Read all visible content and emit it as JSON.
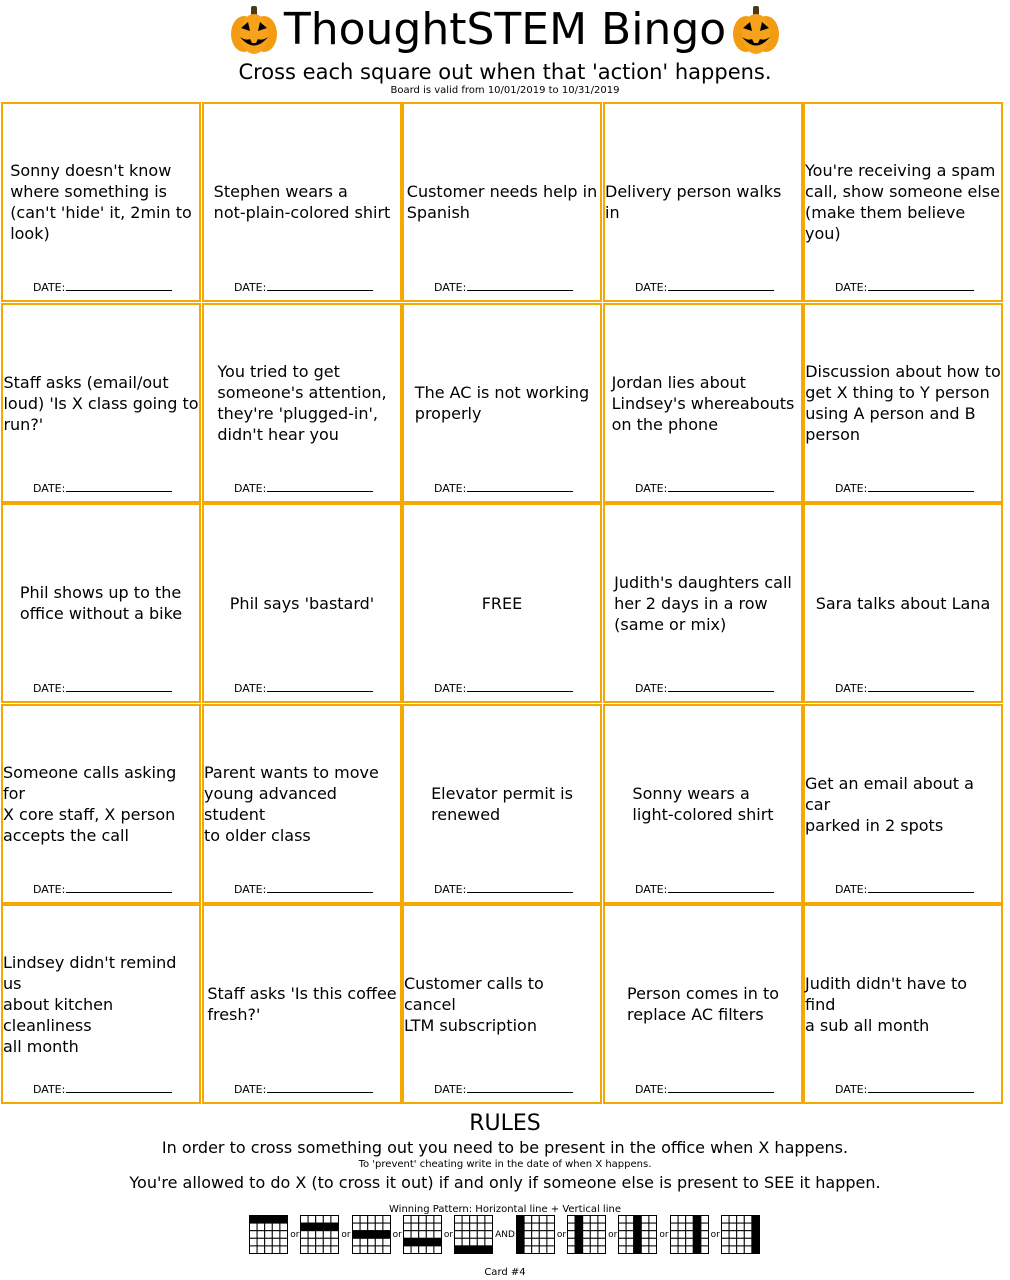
{
  "header": {
    "title": "ThoughtSTEM Bingo",
    "subtitle": "Cross each square out when that 'action' happens.",
    "validity": "Board is valid from 10/01/2019 to 10/31/2019",
    "icon": "pumpkin-icon"
  },
  "board": {
    "date_label": "DATE:",
    "cells": [
      [
        "Sonny doesn't know\nwhere something is\n(can't 'hide' it, 2min to\n look)",
        "Stephen wears a\n not-plain-colored shirt",
        "Customer needs help in\n Spanish",
        "Delivery person walks in",
        "You're receiving a spam\ncall, show someone else\n(make them believe you)"
      ],
      [
        "Staff asks (email/out\nloud) 'Is X class going to\n run?'",
        "You tried to get\nsomeone's attention,\nthey're 'plugged-in',\n didn't hear you",
        "The AC is not working\n properly",
        "Jordan lies about\nLindsey's whereabouts\n on the phone",
        "Discussion about how to\nget X thing to Y person\nusing A person and B\n person"
      ],
      [
        "Phil shows up to the\noffice without a bike",
        "Phil says 'bastard'",
        "FREE",
        "Judith's daughters call\nher 2 days in a row\n (same or mix)",
        "Sara talks about Lana"
      ],
      [
        "Someone calls asking for\nX core staff, X person\n accepts the call",
        "Parent wants to move\nyoung advanced student\n to older class",
        "Elevator permit is\n renewed",
        "Sonny wears a\n light-colored shirt",
        "Get an email about a car\n parked in 2 spots"
      ],
      [
        "Lindsey didn't remind us\nabout kitchen cleanliness\n all month",
        "Staff asks 'Is this coffee\n fresh?'",
        "Customer calls to cancel\n LTM subscription",
        "Person comes in to\n replace AC filters",
        "Judith didn't have to find\n a sub all month"
      ]
    ]
  },
  "rules": {
    "title": "RULES",
    "line1": "In order to cross something out you need to be present in the office when X happens.",
    "small": "To 'prevent' cheating write in the date of when X happens.",
    "line2": "You're allowed to do X (to cross it out) if and only if someone else is present to SEE it happen."
  },
  "winning_pattern": {
    "label": "Winning Pattern: Horizontal line + Vertical line",
    "separators": [
      "or",
      "or",
      "or",
      "or",
      "AND",
      "or",
      "or",
      "or",
      "or"
    ],
    "patterns": [
      {
        "type": "row",
        "index": 0
      },
      {
        "type": "row",
        "index": 1
      },
      {
        "type": "row",
        "index": 2
      },
      {
        "type": "row",
        "index": 3
      },
      {
        "type": "row",
        "index": 4
      },
      {
        "type": "col",
        "index": 0
      },
      {
        "type": "col",
        "index": 1
      },
      {
        "type": "col",
        "index": 2
      },
      {
        "type": "col",
        "index": 3
      },
      {
        "type": "col",
        "index": 4
      }
    ]
  },
  "footer": {
    "card": "Card #4"
  },
  "colors": {
    "cell_border": "#f5a800",
    "pumpkin": "#f7a21b"
  }
}
